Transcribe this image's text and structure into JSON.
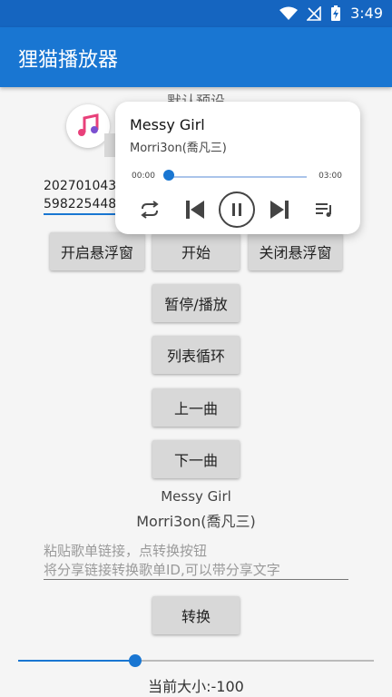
{
  "status_bar": {
    "time": "3:49"
  },
  "app_bar": {
    "title": "狸猫播放器"
  },
  "preset_label": "默认预设",
  "input_lines": [
    "20270104389",
    "59822544812"
  ],
  "buttons": {
    "open_float": "开启悬浮窗",
    "start": "开始",
    "close_float": "关闭悬浮窗",
    "pause_play": "暂停/播放",
    "loop_mode": "列表循环",
    "previous": "上一曲",
    "next": "下一曲",
    "convert": "转换"
  },
  "now_playing": {
    "song": "Messy Girl",
    "artist": "Morri3on(喬凡三)"
  },
  "paste_placeholder": [
    "粘贴歌单链接，点转换按钮",
    "将分享链接转换歌单ID,可以带分享文字"
  ],
  "slider": {
    "value_fraction": 0.33,
    "label": "当前大小:-100"
  },
  "floating_player": {
    "song": "Messy Girl",
    "artist": "Morri3on(喬凡三)",
    "time_current": "00:00",
    "time_total": "03:00",
    "progress_fraction": 0.0,
    "icons": [
      "repeat-icon",
      "skip-previous-icon",
      "pause-icon",
      "skip-next-icon",
      "playlist-icon"
    ]
  },
  "colors": {
    "primary": "#1976d2",
    "status_bar": "#1565c0",
    "button": "#d8d8d8"
  }
}
